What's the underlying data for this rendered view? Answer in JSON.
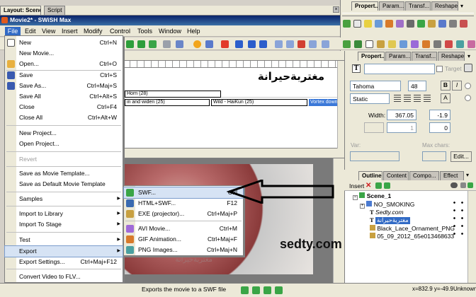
{
  "layout_tabs": [
    {
      "label": "Layout: Scene_1"
    },
    {
      "label": "Script"
    }
  ],
  "app_title": "Movie2* - SWiSH Max",
  "menubar": [
    "File",
    "Edit",
    "View",
    "Insert",
    "Modify",
    "Control",
    "Tools",
    "Window",
    "Help"
  ],
  "top_panel_tabs": [
    "Propert...",
    "Param...",
    "Transf...",
    "Reshape"
  ],
  "mid_panel_tabs": [
    "Propert...",
    "Param...",
    "Transf...",
    "Reshape"
  ],
  "timeline": {
    "arabic_title": "مغتربةحيرانة",
    "rows": [
      "Horn (28)",
      "in and widen (25)",
      "Wild - HaiKun (25)",
      "Vortex down and"
    ]
  },
  "file_menu": {
    "items": [
      {
        "label": "New",
        "shortcut": "Ctrl+N",
        "icon": "new-file-icon"
      },
      {
        "label": "New Movie...",
        "shortcut": "",
        "icon": ""
      },
      {
        "label": "Open...",
        "shortcut": "Ctrl+O",
        "icon": "open-folder-icon"
      },
      {
        "label": "Save",
        "shortcut": "Ctrl+S",
        "icon": "save-disk-icon"
      },
      {
        "label": "Save As...",
        "shortcut": "Ctrl+Maj+S",
        "icon": "save-as-icon"
      },
      {
        "label": "Save All",
        "shortcut": "Ctrl+Alt+S",
        "icon": ""
      },
      {
        "label": "Close",
        "shortcut": "Ctrl+F4",
        "icon": ""
      },
      {
        "label": "Close All",
        "shortcut": "Ctrl+Alt+W",
        "icon": ""
      },
      {
        "label": "New Project...",
        "shortcut": "",
        "icon": ""
      },
      {
        "label": "Open Project...",
        "shortcut": "",
        "icon": ""
      },
      {
        "label": "Revert",
        "shortcut": "",
        "icon": ""
      },
      {
        "label": "Save as Movie Template...",
        "shortcut": "",
        "icon": ""
      },
      {
        "label": "Save as Default Movie Template",
        "shortcut": "",
        "icon": ""
      },
      {
        "label": "Samples",
        "shortcut": "",
        "icon": ""
      },
      {
        "label": "Import to Library",
        "shortcut": "",
        "icon": ""
      },
      {
        "label": "Import To Stage",
        "shortcut": "",
        "icon": ""
      },
      {
        "label": "Test",
        "shortcut": "",
        "icon": ""
      },
      {
        "label": "Export",
        "shortcut": "",
        "icon": ""
      },
      {
        "label": "Export Settings...",
        "shortcut": "Ctrl+Maj+F12",
        "icon": ""
      },
      {
        "label": "Convert Video to FLV...",
        "shortcut": "",
        "icon": ""
      }
    ]
  },
  "export_menu": {
    "items": [
      {
        "label": "SWF...",
        "shortcut": "Ctrl"
      },
      {
        "label": "HTML+SWF...",
        "shortcut": "F12"
      },
      {
        "label": "EXE (projector)...",
        "shortcut": "Ctrl+Maj+P"
      },
      {
        "label": "AVI Movie...",
        "shortcut": "Ctrl+M"
      },
      {
        "label": "GIF Animation...",
        "shortcut": "Ctrl+Maj+F"
      },
      {
        "label": "PNG Images...",
        "shortcut": "Ctrl+Maj+N"
      }
    ]
  },
  "watermark": "sedty.com",
  "stage_text": "مغتربةحيرانة",
  "properties": {
    "target_label": "Target",
    "font": "Tahoma",
    "size": "48",
    "text_type": "Static",
    "width_label": "Width:",
    "width_value": "367.05",
    "spacing_value": "-1.9",
    "lines_value": "1",
    "lines_spin": "0",
    "var_label": "Var:",
    "max_chars_label": "Max chars:",
    "edit_button": "Edit...",
    "bold": "B",
    "italic": "I",
    "align_a": "A"
  },
  "outline": {
    "tabs": [
      "Outline",
      "Content",
      "Compo...",
      "Effect"
    ],
    "insert_label": "Insert",
    "nodes": [
      {
        "label": "Scene_1",
        "icon": "scene-icon"
      },
      {
        "label": "NO_SMOKING",
        "icon": "sprite-icon"
      },
      {
        "label": "Sedty.com",
        "icon": "text-icon"
      },
      {
        "label": "مغتربةحيرانة",
        "icon": "text-icon"
      },
      {
        "label": "Black_Lace_Ornament_PNG",
        "icon": "image-icon"
      },
      {
        "label": "05_09_2012_65e013468633",
        "icon": "image-icon"
      }
    ]
  },
  "status": {
    "message": "Exports the movie to a SWF file",
    "coords": "x=832.9 y=-49.9",
    "state": "Unknown Se"
  }
}
